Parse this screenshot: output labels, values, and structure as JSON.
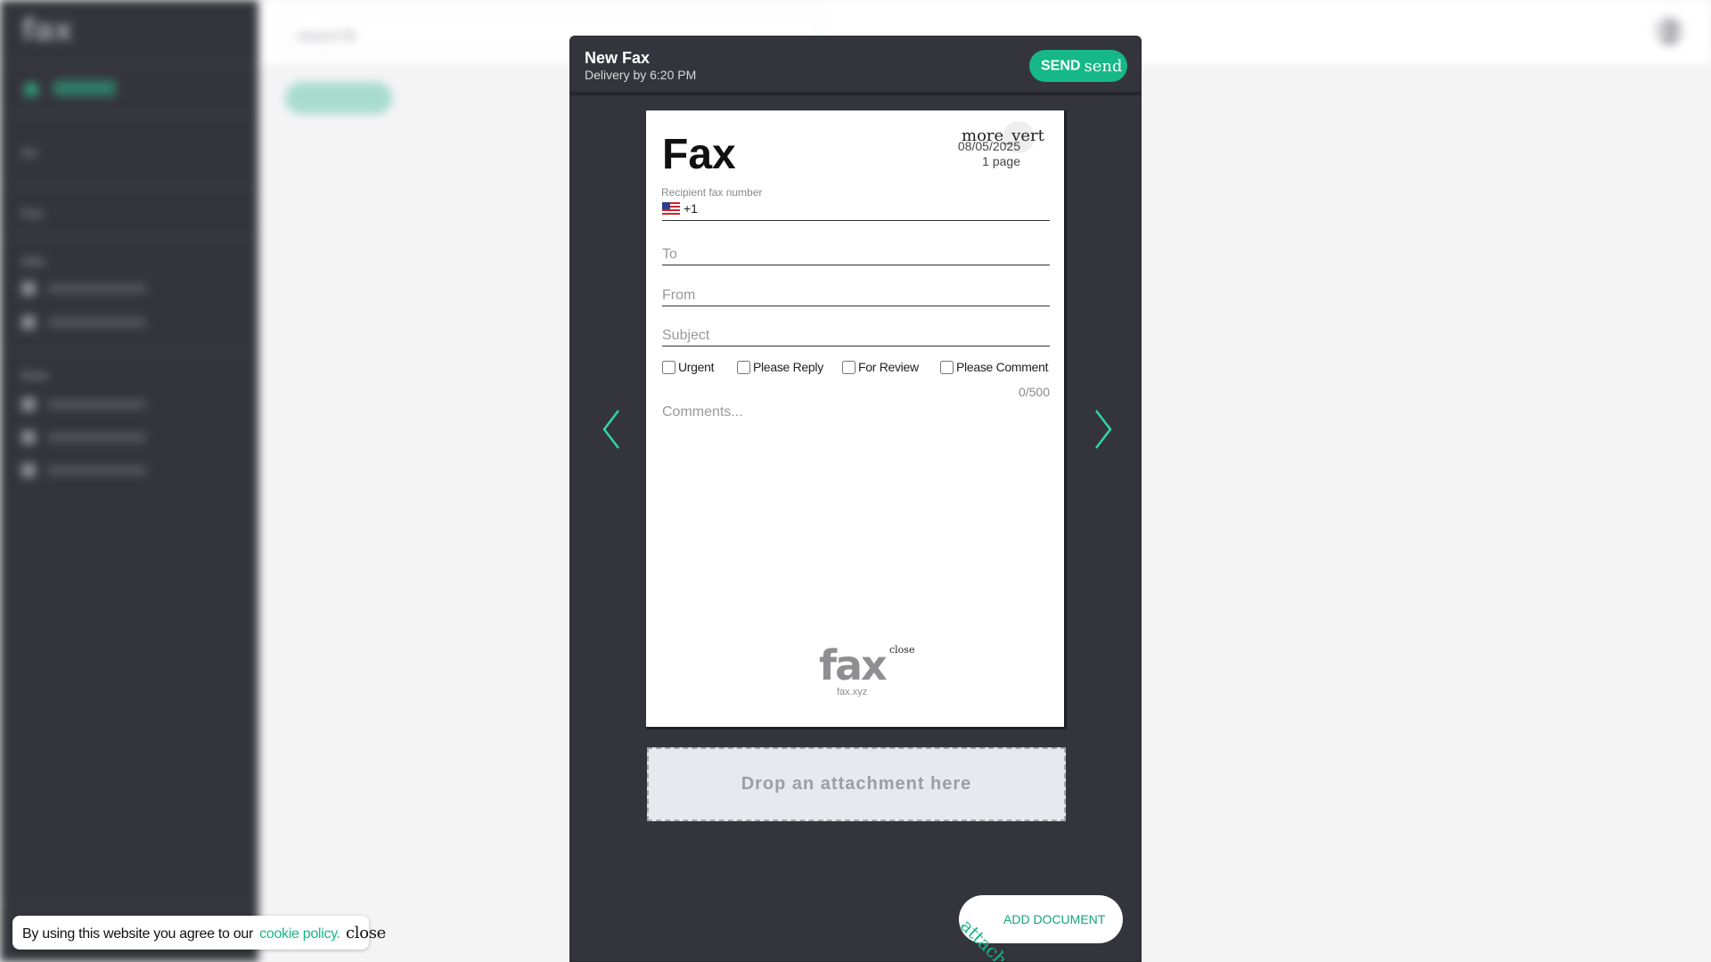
{
  "app": {
    "logo": "fax",
    "search_placeholder": "search"
  },
  "sidebar": {
    "headings": [
      "Su",
      "Fax",
      "Abo",
      "Dow"
    ]
  },
  "modal": {
    "title": "New Fax",
    "subtitle": "Delivery by 6:20 PM",
    "send_label": "SEND",
    "send_icon": "send",
    "page": {
      "title": "Fax",
      "menu_icon": "more_vert",
      "date": "08/05/2025",
      "page_count": "1 page",
      "recipient_label": "Recipient fax number",
      "country_prefix": "+1",
      "to_placeholder": "To",
      "from_placeholder": "From",
      "subject_placeholder": "Subject",
      "checkboxes": [
        "Urgent",
        "Please Reply",
        "For Review",
        "Please Comment"
      ],
      "char_count": "0/500",
      "comments_placeholder": "Comments...",
      "logo_text": "fax",
      "logo_sub": "fax.xyz",
      "logo_close": "close"
    },
    "drop_zone": "Drop an attachment here",
    "add_document_label": "ADD DOCUMENT",
    "add_document_icon": "attach_file"
  },
  "cookie": {
    "text": "By using this website you agree to our",
    "link": "cookie policy.",
    "close": "close"
  },
  "colors": {
    "accent": "#15b886",
    "modal_bg": "#34353c",
    "sidebar_bg": "#34353c"
  }
}
